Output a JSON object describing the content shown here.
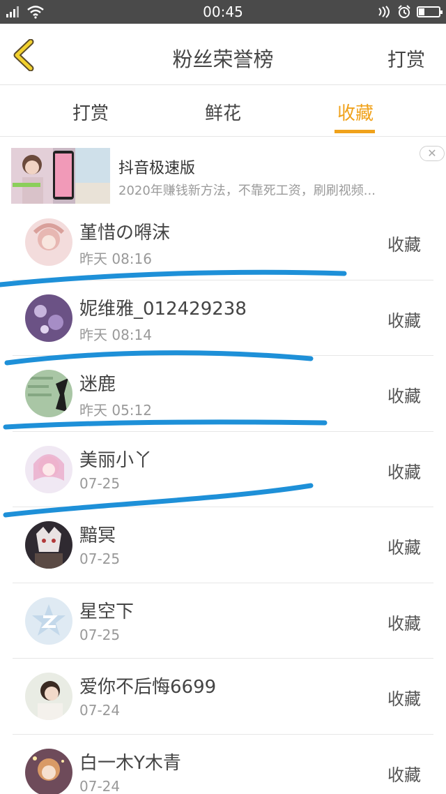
{
  "status_bar": {
    "time": "00:45",
    "left_icons": [
      "signal-icon",
      "wifi-icon"
    ],
    "right_icons": [
      "nfc-icon",
      "alarm-icon",
      "battery-icon"
    ],
    "battery_level": 0.3
  },
  "header": {
    "title": "粉丝荣誉榜",
    "right_action": "打赏"
  },
  "tabs": [
    {
      "label": "打赏",
      "active": false
    },
    {
      "label": "鲜花",
      "active": false
    },
    {
      "label": "收藏",
      "active": true
    }
  ],
  "ad": {
    "title": "抖音极速版",
    "description": "2020年赚钱新方法，不靠死工资，刷刷视频..."
  },
  "list": [
    {
      "name": "堇惜の嘚沫",
      "time": "昨天 08:16",
      "action": "收藏"
    },
    {
      "name": "妮维雅_012429238",
      "time": "昨天 08:14",
      "action": "收藏"
    },
    {
      "name": "迷鹿",
      "time": "昨天 05:12",
      "action": "收藏"
    },
    {
      "name": "美丽小丫",
      "time": "07-25",
      "action": "收藏"
    },
    {
      "name": "黯冥",
      "time": "07-25",
      "action": "收藏"
    },
    {
      "name": "星空下",
      "time": "07-25",
      "action": "收藏"
    },
    {
      "name": "爱你不后悔6699",
      "time": "07-24",
      "action": "收藏"
    },
    {
      "name": "白一木Y木青",
      "time": "07-24",
      "action": "收藏"
    }
  ],
  "colors": {
    "accent": "#f0a21b",
    "status_bar": "#4a4a4a",
    "annotation_stroke": "#1e90d8"
  }
}
